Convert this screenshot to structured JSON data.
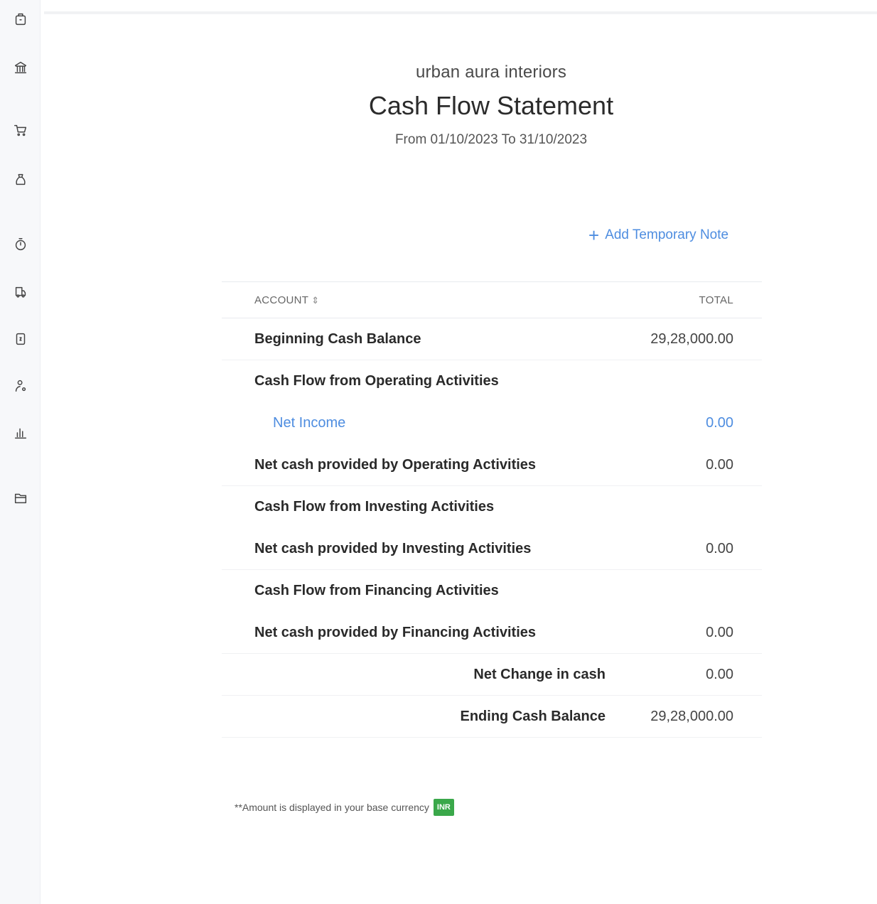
{
  "sidebar": {
    "icons": [
      "box-icon",
      "bank-icon",
      "cart-icon",
      "bag-icon",
      "clock-icon",
      "truck-icon",
      "document-icon",
      "user-icon",
      "chart-icon",
      "folder-icon"
    ]
  },
  "report": {
    "organization": "urban aura interiors",
    "title": "Cash Flow Statement",
    "period": "From 01/10/2023 To 31/10/2023",
    "add_note_label": "Add Temporary Note",
    "columns": {
      "account": "ACCOUNT",
      "total": "TOTAL"
    },
    "rows": {
      "beginning": {
        "label": "Beginning Cash Balance",
        "amount": "29,28,000.00"
      },
      "operating_header": {
        "label": "Cash Flow from Operating Activities"
      },
      "net_income": {
        "label": "Net Income",
        "amount": "0.00"
      },
      "operating_net": {
        "label": "Net cash provided by Operating Activities",
        "amount": "0.00"
      },
      "investing_header": {
        "label": "Cash Flow from Investing Activities"
      },
      "investing_net": {
        "label": "Net cash provided by Investing Activities",
        "amount": "0.00"
      },
      "financing_header": {
        "label": "Cash Flow from Financing Activities"
      },
      "financing_net": {
        "label": "Net cash provided by Financing Activities",
        "amount": "0.00"
      },
      "net_change": {
        "label": "Net Change in cash",
        "amount": "0.00"
      },
      "ending": {
        "label": "Ending Cash Balance",
        "amount": "29,28,000.00"
      }
    },
    "footnote": "**Amount is displayed in your base currency",
    "currency_badge": "INR"
  }
}
